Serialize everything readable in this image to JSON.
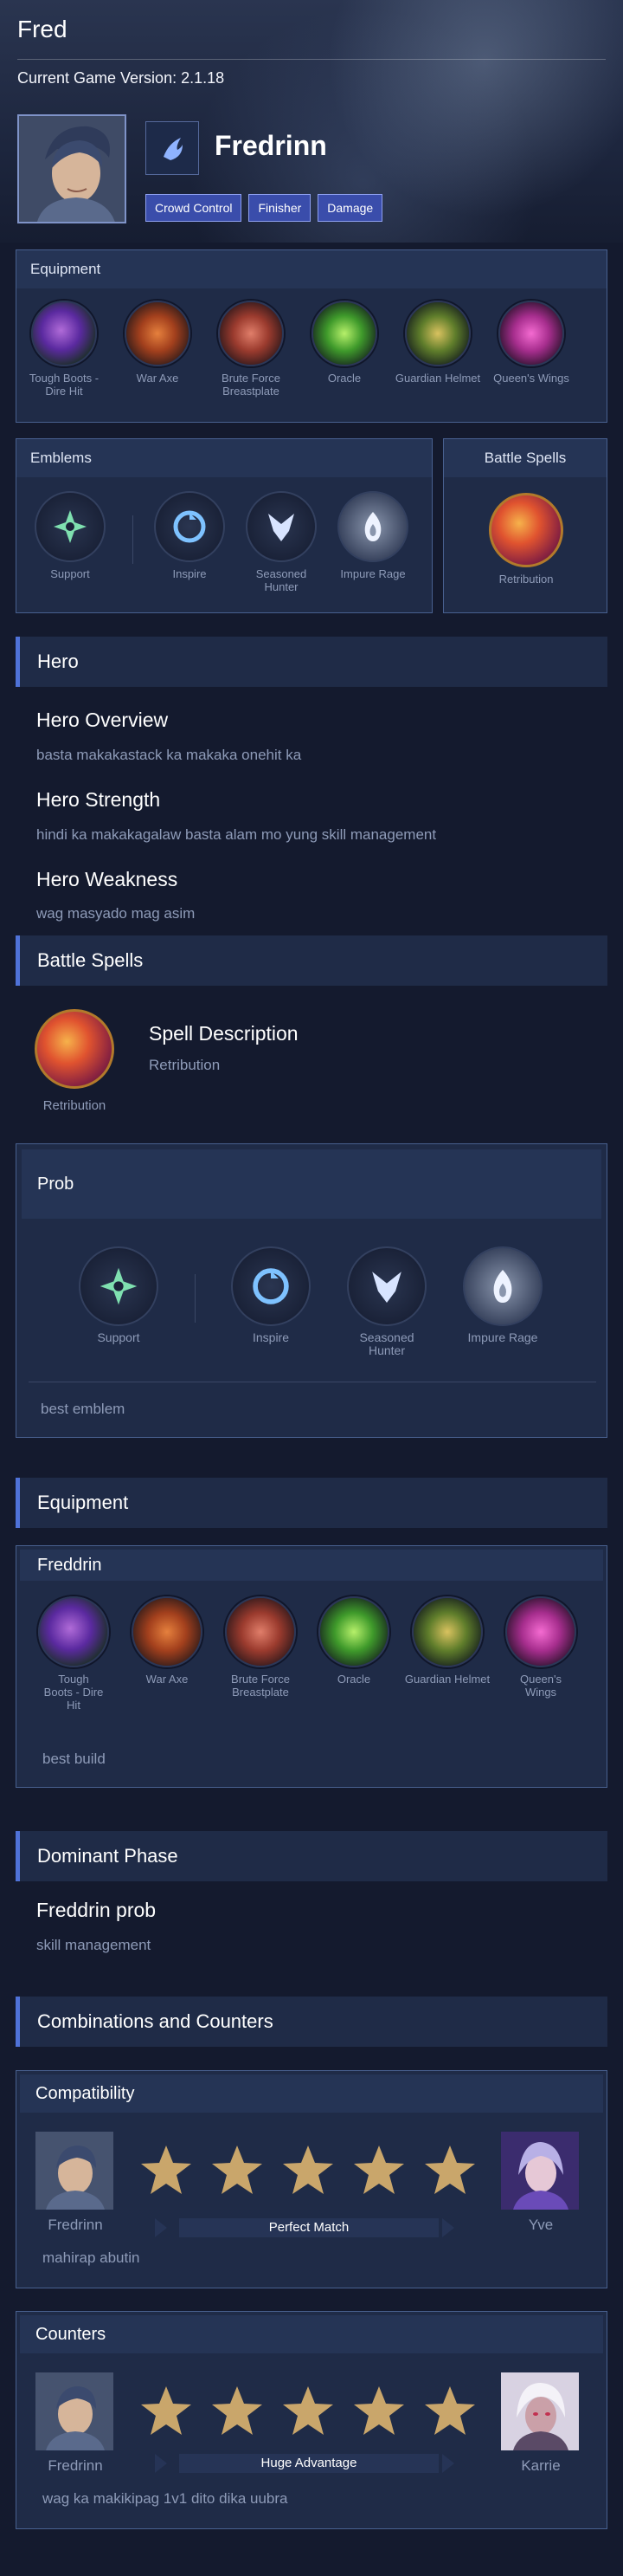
{
  "page": {
    "title": "Fred",
    "version_label": "Current Game Version: 2.1.18"
  },
  "hero": {
    "name": "Fredrinn",
    "tags": [
      "Crowd Control",
      "Finisher",
      "Damage"
    ]
  },
  "equipment_box": {
    "title": "Equipment",
    "items": [
      {
        "label": "Tough Boots - Dire Hit",
        "color": "#8a4dc0"
      },
      {
        "label": "War Axe",
        "color": "#c2532a"
      },
      {
        "label": "Brute Force Breastplate",
        "color": "#b14a3a"
      },
      {
        "label": "Oracle",
        "color": "#5db33b"
      },
      {
        "label": "Guardian Helmet",
        "color": "#8c9a3a"
      },
      {
        "label": "Queen's Wings",
        "color": "#d046b0"
      }
    ]
  },
  "emblems_box": {
    "title": "Emblems",
    "items": [
      {
        "label": "Support",
        "icon": "support-emblem-icon"
      },
      {
        "label": "Inspire",
        "icon": "inspire-talent-icon"
      },
      {
        "label": "Seasoned Hunter",
        "icon": "seasoned-hunter-talent-icon"
      },
      {
        "label": "Impure Rage",
        "icon": "impure-rage-talent-icon"
      }
    ]
  },
  "spells_box": {
    "title": "Battle Spells",
    "spell_label": "Retribution"
  },
  "hero_section": {
    "title": "Hero",
    "overview_title": "Hero Overview",
    "overview_text": "basta makakastack ka makaka onehit ka",
    "strength_title": "Hero Strength",
    "strength_text": "hindi ka makakagalaw basta alam mo yung skill management",
    "weakness_title": "Hero Weakness",
    "weakness_text": "wag masyado mag asim"
  },
  "battle_spells_section": {
    "title": "Battle Spells",
    "spell_label": "Retribution",
    "description_title": "Spell Description",
    "description_text": "Retribution"
  },
  "prob_box": {
    "title": "Prob",
    "items": [
      {
        "label": "Support"
      },
      {
        "label": "Inspire"
      },
      {
        "label": "Seasoned Hunter"
      },
      {
        "label": "Impure Rage"
      }
    ],
    "note": "best emblem"
  },
  "equipment_section": {
    "title": "Equipment",
    "build_title": "Freddrin",
    "items": [
      {
        "label": "Tough Boots - Dire Hit"
      },
      {
        "label": "War Axe"
      },
      {
        "label": "Brute Force Breastplate"
      },
      {
        "label": "Oracle"
      },
      {
        "label": "Guardian Helmet"
      },
      {
        "label": "Queen's Wings"
      }
    ],
    "note": "best build"
  },
  "dominant_phase": {
    "title": "Dominant Phase",
    "subtitle": "Freddrin prob",
    "text": "skill management"
  },
  "combos": {
    "title": "Combinations and Counters",
    "compatibility": {
      "title": "Compatibility",
      "left_hero": "Fredrinn",
      "right_hero": "Yve",
      "stars": 5,
      "result": "Perfect Match",
      "note": "mahirap abutin"
    },
    "counters": {
      "title": "Counters",
      "left_hero": "Fredrinn",
      "right_hero": "Karrie",
      "stars": 5,
      "result": "Huge Advantage",
      "note": "wag ka makikipag 1v1 dito dika uubra"
    }
  },
  "colors": {
    "accent": "#4f72d8",
    "tag_bg": "#3a4dab",
    "panel": "#1f2b47",
    "star": "#c9a66b"
  }
}
